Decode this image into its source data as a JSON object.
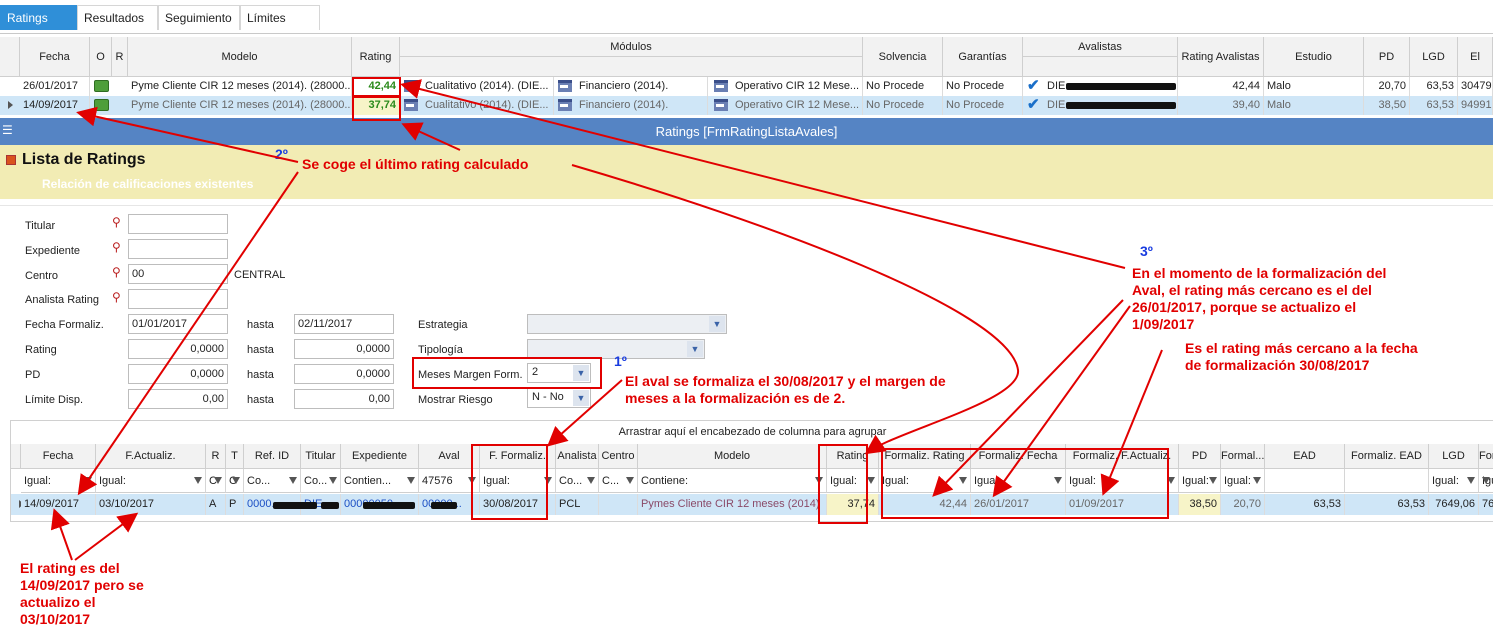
{
  "tabs": [
    "Ratings",
    "Resultados",
    "Seguimiento",
    "Límites"
  ],
  "top_grid": {
    "headers": {
      "fecha": "Fecha",
      "o": "O",
      "r": "R",
      "modelo": "Modelo",
      "rating": "Rating",
      "modulos": "Módulos",
      "solvencia": "Solvencia",
      "garantias": "Garantías",
      "avalistas": "Avalistas",
      "rating_avalistas": "Rating Avalistas",
      "estudio": "Estudio",
      "pd": "PD",
      "lgd": "LGD",
      "el": "El"
    },
    "rows": [
      {
        "fecha": "26/01/2017",
        "modelo": "Pyme Cliente CIR 12 meses (2014). (28000...",
        "rating": "42,44",
        "mod1": "Cualitativo (2014). (DIE...",
        "mod2": "Financiero (2014).",
        "mod3": "Operativo CIR 12 Mese...",
        "solvencia": "No Procede",
        "garantias": "No Procede",
        "avalista": "DIE",
        "rating_avalistas": "42,44",
        "estudio": "Malo",
        "pd": "20,70",
        "lgd": "63,53",
        "el": "30479"
      },
      {
        "fecha": "14/09/2017",
        "modelo": "Pyme Cliente CIR 12 meses (2014). (28000...",
        "rating": "37,74",
        "mod1": "Cualitativo (2014). (DIE...",
        "mod2": "Financiero (2014).",
        "mod3": "Operativo CIR 12 Mese...",
        "solvencia": "No Procede",
        "garantias": "No Procede",
        "avalista": "DIE",
        "rating_avalistas": "39,40",
        "estudio": "Malo",
        "pd": "38,50",
        "lgd": "63,53",
        "el": "94991"
      }
    ]
  },
  "window_title": "Ratings [FrmRatingListaAvales]",
  "panel": {
    "title": "Lista de Ratings",
    "subtitle": "Relación de calificaciones existentes"
  },
  "form": {
    "titular": "Titular",
    "expediente": "Expediente",
    "centro": "Centro",
    "centro_value": "00",
    "centro_name": "CENTRAL",
    "analista": "Analista Rating",
    "fecha_formaliz": "Fecha Formaliz.",
    "fecha_desde": "01/01/2017",
    "hasta": "hasta",
    "fecha_hasta": "02/11/2017",
    "rating": "Rating",
    "rating_desde": "0,0000",
    "rating_hasta": "0,0000",
    "pd": "PD",
    "pd_desde": "0,0000",
    "pd_hasta": "0,0000",
    "limite": "Límite Disp.",
    "limite_desde": "0,00",
    "limite_hasta": "0,00",
    "estrategia": "Estrategia",
    "tipologia": "Tipología",
    "meses_margen": "Meses Margen Form.",
    "meses_value": "2",
    "mostrar_riesgo": "Mostrar Riesgo",
    "riesgo_value": "N - No"
  },
  "bottom_grid": {
    "group_hint": "Arrastrar aquí el encabezado de columna para agrupar",
    "headers": [
      "Fecha",
      "F.Actualiz.",
      "R",
      "T",
      "Ref. ID",
      "Titular",
      "Expediente",
      "Aval",
      "F. Formaliz.",
      "Analista",
      "Centro",
      "Modelo",
      "Rating",
      "Formaliz. Rating",
      "Formaliz. Fecha",
      "Formaliz. F.Actualiz.",
      "PD",
      "Formal...",
      "EAD",
      "Formaliz. EAD",
      "LGD",
      "For"
    ],
    "filters": [
      "Igual:",
      "Igual:",
      "C",
      "C",
      "Co...",
      "Co...",
      "Contien...",
      "47576",
      "Igual:",
      "Co...",
      "C...",
      "Contiene:",
      "Igual:",
      "Igual:",
      "Igual:",
      "Igual:",
      "Igual:",
      "Igual:",
      "",
      "",
      "Igual:",
      "Igu"
    ],
    "row": [
      "14/09/2017",
      "03/10/2017",
      "A",
      "P",
      "0000...",
      "DIE...",
      "00000050...",
      "00000...",
      "30/08/2017",
      "PCL",
      "",
      "Pymes Cliente CIR 12 meses (2014)",
      "37,74",
      "42,44",
      "26/01/2017",
      "01/09/2017",
      "38,50",
      "20,70",
      "63,53",
      "63,53",
      "7649,06",
      "76"
    ]
  },
  "annotations": {
    "n1": "1º",
    "n2": "2º",
    "n3": "3º",
    "a2": "Se coge el último rating calculado",
    "a1_l1": "El aval se formaliza el 30/08/2017 y el margen de",
    "a1_l2": "meses a la formalización es de 2.",
    "a3_l1": "En el momento de la formalización del",
    "a3_l2": "Aval, el rating más cercano es el del",
    "a3_l3": "26/01/2017, porque se actualizo el",
    "a3_l4": "1/09/2017",
    "a4_l1": "Es el rating más cercano a la fecha",
    "a4_l2": "de formalización 30/08/2017",
    "a5_l1": "El rating es del",
    "a5_l2": "14/09/2017 pero se",
    "a5_l3": "actualizo el",
    "a5_l4": "03/10/2017"
  }
}
